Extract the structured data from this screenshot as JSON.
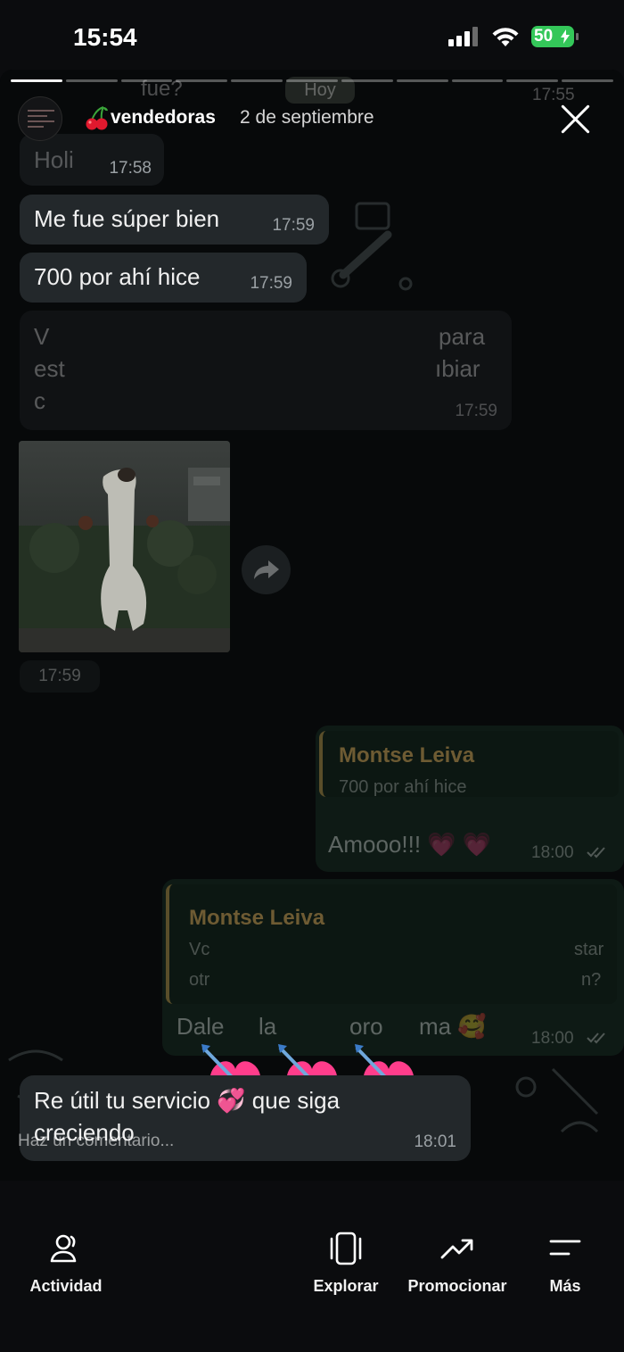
{
  "status_bar": {
    "time": "15:54",
    "battery": "50"
  },
  "story": {
    "username": "vendedoras",
    "date": "2 de septiembre",
    "progress_done": 1,
    "progress_total": 11
  },
  "background": {
    "top_fragment": "fue?",
    "day_label": "Hoy",
    "top_time": "17:55"
  },
  "messages": {
    "holi": {
      "text": "Holi",
      "time": "17:58"
    },
    "m1": {
      "text": "Me fue súper bien",
      "time": "17:59"
    },
    "m2": {
      "text": "700 por ahí hice",
      "time": "17:59"
    },
    "blurred": {
      "frag1": "V",
      "frag2": "para",
      "frag3": "est",
      "frag4": "ıbiar",
      "frag5": "c",
      "time": "17:59"
    },
    "photo_time": "17:59",
    "out1": {
      "reply_name": "Montse Leiva",
      "reply_text": "700 por ahí hice",
      "text": "Amooo!!! 💗 💗",
      "time": "18:00"
    },
    "out2": {
      "reply_name": "Montse Leiva",
      "reply_frag1": "Vc",
      "reply_frag2": "star",
      "reply_frag3": "otr",
      "reply_frag4": "n?",
      "text_left": "Dale",
      "text_mid": "la",
      "text_mid2": "oro",
      "text_right": "ma 🥰",
      "time": "18:00"
    },
    "last": {
      "text": "Re útil tu servicio 💞 que siga creciendo",
      "time": "18:01"
    }
  },
  "comment_placeholder": "Haz un comentario...",
  "nav": [
    {
      "label": "Actividad",
      "icon": "activity-icon"
    },
    {
      "label": "Explorar",
      "icon": "explore-icon"
    },
    {
      "label": "Promocionar",
      "icon": "promote-icon"
    },
    {
      "label": "Más",
      "icon": "more-icon"
    }
  ],
  "colors": {
    "incoming_bubble": "#23282b",
    "outgoing_bubble": "#0e1a15",
    "battery": "#34c759",
    "heart": "#ff3d8b"
  }
}
